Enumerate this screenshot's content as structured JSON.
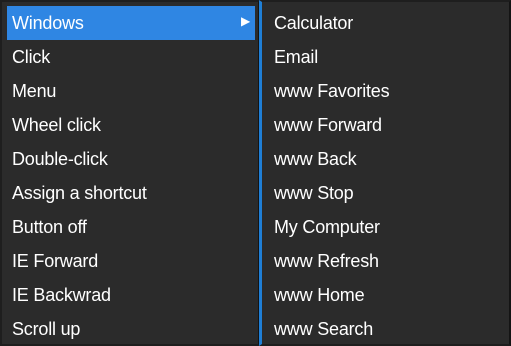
{
  "main_menu": {
    "items": [
      {
        "label": "Windows",
        "submenu_arrow": "▶"
      },
      {
        "label": "Click"
      },
      {
        "label": "Menu"
      },
      {
        "label": "Wheel click"
      },
      {
        "label": "Double-click"
      },
      {
        "label": "Assign a shortcut"
      },
      {
        "label": "Button off"
      },
      {
        "label": "IE Forward"
      },
      {
        "label": "IE Backwrad"
      },
      {
        "label": "Scroll up"
      }
    ],
    "selected_index": 0
  },
  "submenu": {
    "items": [
      {
        "label": "Calculator"
      },
      {
        "label": "Email"
      },
      {
        "label": "www Favorites"
      },
      {
        "label": "www Forward"
      },
      {
        "label": "www Back"
      },
      {
        "label": "www Stop"
      },
      {
        "label": "My Computer"
      },
      {
        "label": "www Refresh"
      },
      {
        "label": "www Home"
      },
      {
        "label": "www Search"
      }
    ]
  },
  "colors": {
    "menu_background": "#2b2b2b",
    "selection": "#2f86e3",
    "submenu_accent": "#1f7fd6",
    "text": "#ffffff"
  }
}
